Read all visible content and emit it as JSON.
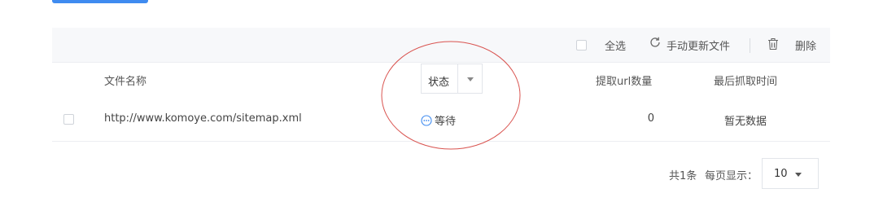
{
  "toolbar": {
    "select_all_label": "全选",
    "refresh_label": "手动更新文件",
    "delete_label": "删除"
  },
  "table": {
    "columns": {
      "name": "文件名称",
      "status": "状态",
      "url_count": "提取url数量",
      "last_crawl": "最后抓取时间"
    },
    "rows": [
      {
        "filename": "http://www.komoye.com/sitemap.xml",
        "status": "等待",
        "url_count": "0",
        "last_crawl": "暂无数据"
      }
    ]
  },
  "pagination": {
    "total": "共1条",
    "per_page_label": "每页显示：",
    "per_page_value": "10"
  },
  "colors": {
    "accent": "#3f8bf0",
    "annotation": "#d9534f",
    "status_icon": "#3f8bf0"
  }
}
